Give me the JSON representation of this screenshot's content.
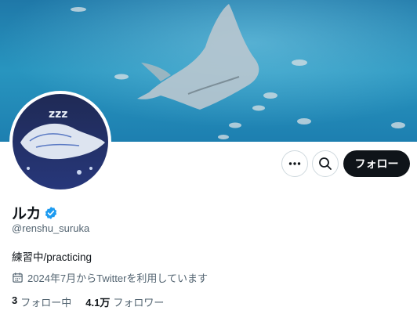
{
  "profile": {
    "name": "ルカ",
    "handle": "@renshu_suruka",
    "bio": "練習中/practicing",
    "joined": "2024年7月からTwitterを利用しています"
  },
  "actions": {
    "more_icon": "ellipsis-icon",
    "search_icon": "search-icon",
    "follow_label": "フォロー"
  },
  "stats": [
    {
      "count": "3",
      "label": "フォロー中"
    },
    {
      "count": "4.1万",
      "label": "フォロワー"
    }
  ],
  "icons": {
    "verified": "verified-badge-icon",
    "calendar": "calendar-icon"
  },
  "colors": {
    "verified_blue": "#1d9bf0",
    "follow_button_bg": "#0f1419",
    "secondary_text": "#536471",
    "banner_water": "#2a8fb8"
  }
}
